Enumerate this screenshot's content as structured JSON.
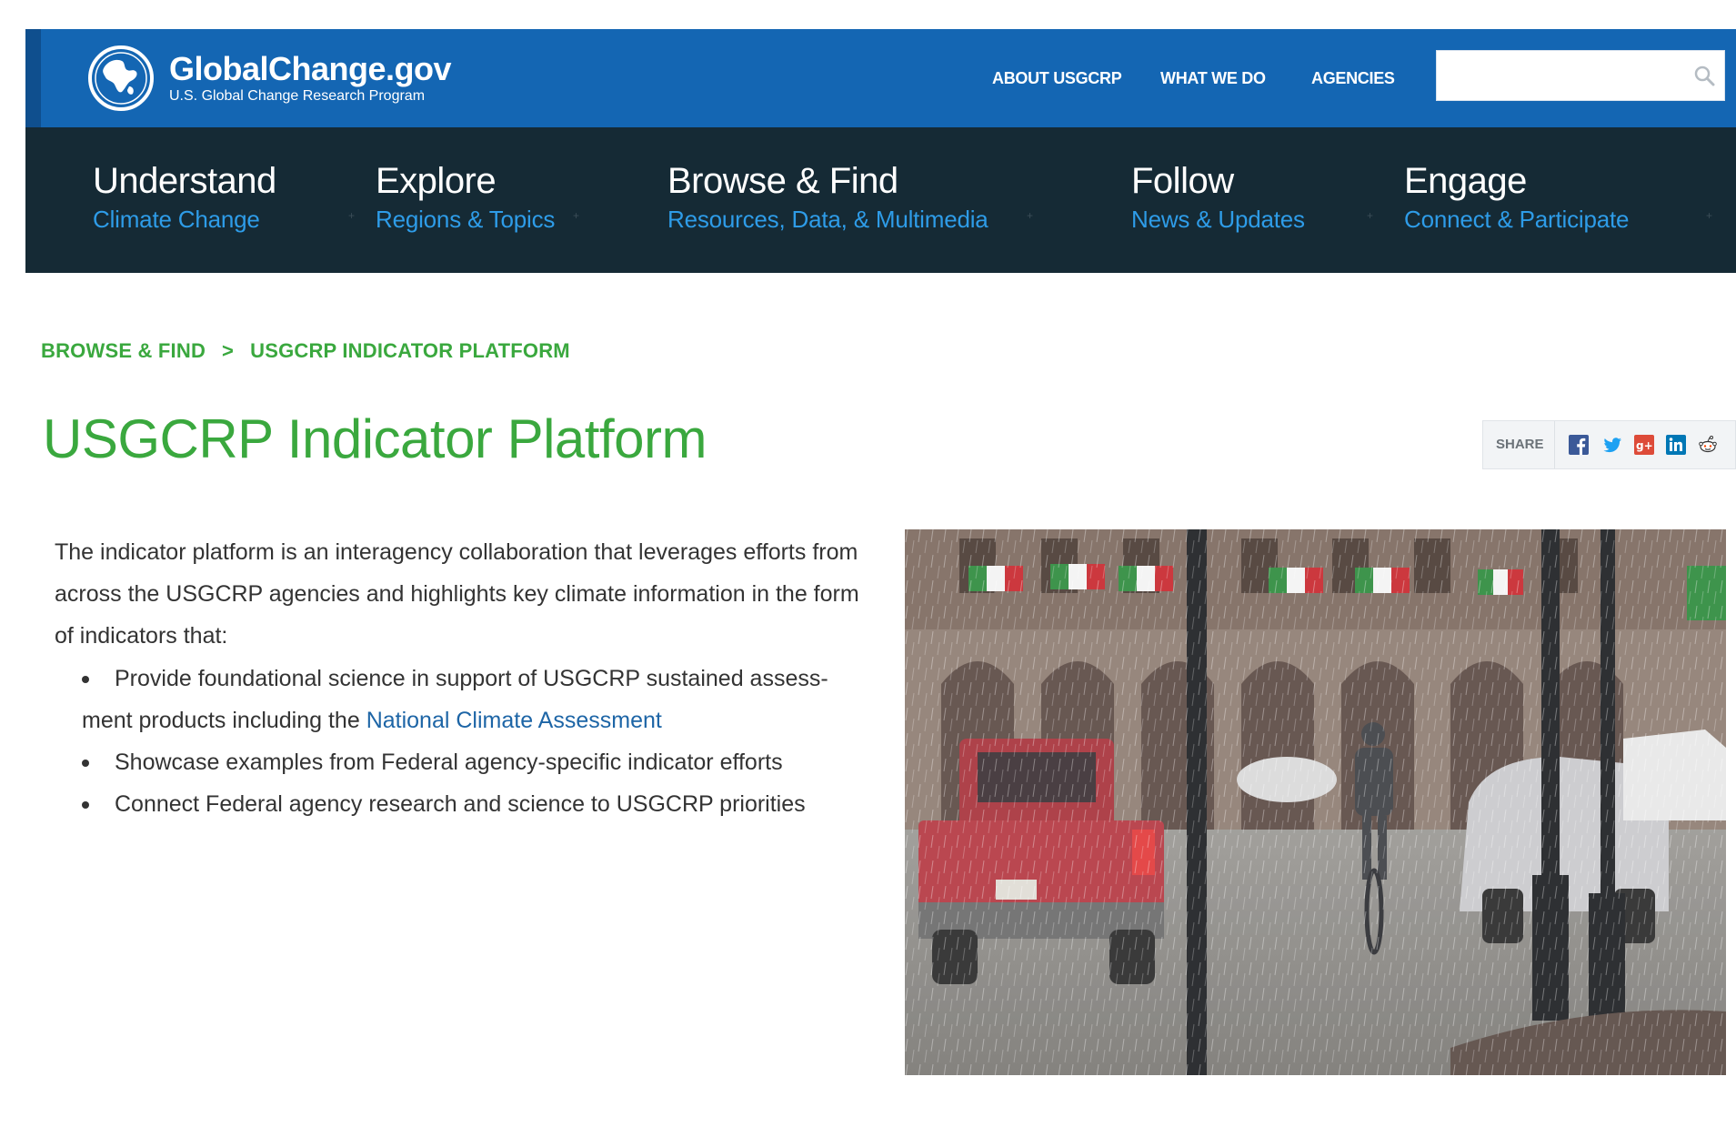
{
  "header": {
    "logo_title": "GlobalChange.gov",
    "logo_subtitle": "U.S. Global Change Research Program",
    "top_nav": [
      "ABOUT USGCRP",
      "WHAT WE DO",
      "AGENCIES"
    ],
    "search_placeholder": ""
  },
  "main_nav": [
    {
      "title": "Understand",
      "subtitle": "Climate Change"
    },
    {
      "title": "Explore",
      "subtitle": "Regions & Topics"
    },
    {
      "title": "Browse & Find",
      "subtitle": "Resources, Data, & Multimedia"
    },
    {
      "title": "Follow",
      "subtitle": "News & Updates"
    },
    {
      "title": "Engage",
      "subtitle": "Connect & Participate"
    }
  ],
  "breadcrumb": {
    "parent": "BROWSE & FIND",
    "separator": ">",
    "current": "USGCRP INDICATOR PLATFORM"
  },
  "page_title": "USGCRP Indicator Platform",
  "share": {
    "label": "SHARE",
    "icons": [
      "facebook-icon",
      "twitter-icon",
      "google-plus-icon",
      "linkedin-icon",
      "reddit-icon"
    ]
  },
  "content": {
    "intro": "The indicator platform is an interagency collaboration that leverages efforts from across the USGCRP agencies and highlights key climate information in the form of indicators that:",
    "bullets": [
      {
        "text": "Provide foundational science in support of USGCRP sustained assess-ment products including the ",
        "link": "National Climate Assessment"
      },
      {
        "text": "Showcase examples from Federal agency-specific indicator efforts"
      },
      {
        "text": "Connect Federal agency research and science to USGCRP priorities"
      }
    ]
  },
  "colors": {
    "header_blue": "#1466b3",
    "nav_dark": "#152a35",
    "nav_sub_blue": "#2e9ce8",
    "green": "#3aa83e",
    "link_blue": "#1d65a6"
  }
}
